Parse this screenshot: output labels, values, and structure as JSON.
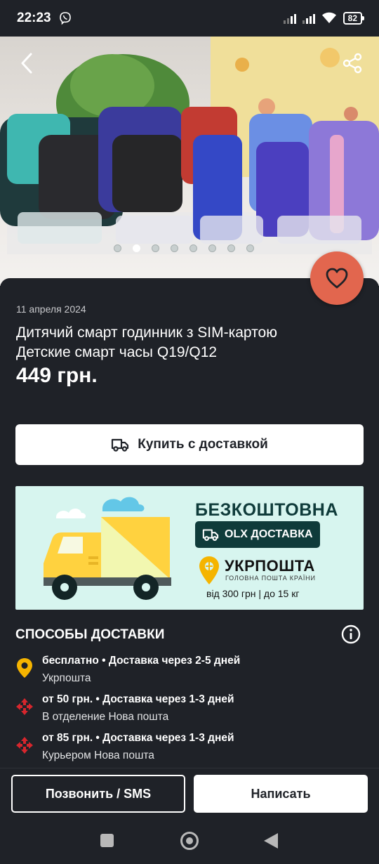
{
  "status_bar": {
    "time": "22:23",
    "battery": "82"
  },
  "gallery": {
    "total_images": 8,
    "active_index": 1
  },
  "listing": {
    "date": "11 апреля 2024",
    "title": "Дитячий смарт годинник з SIM-картою Детские смарт часы  Q19/Q12",
    "price": "449 грн."
  },
  "buy_button": {
    "label": "Купить с доставкой"
  },
  "banner": {
    "headline": "БЕЗКОШТОВНА",
    "olx_label": "OLX ДОСТАВКА",
    "ukrposhta_name": "УКРПОШТА",
    "ukrposhta_tagline": "ГОЛОВНА ПОШТА КРАЇНИ",
    "conditions": "від 300 грн | до 15 кг"
  },
  "delivery": {
    "title": "СПОСОБЫ ДОСТАВКИ",
    "methods": [
      {
        "icon": "ukrposhta-icon",
        "price": "бесплатно",
        "term": "Доставка через 2-5 дней",
        "line1": "бесплатно • Доставка через 2-5 дней",
        "carrier": "Укрпошта"
      },
      {
        "icon": "nova-poshta-icon",
        "price": "от 50 грн.",
        "term": "Доставка через 1-3 дней",
        "line1": "от 50 грн. • Доставка через 1-3 дней",
        "carrier": "В отделение Нова пошта"
      },
      {
        "icon": "nova-poshta-icon",
        "price": "от 85 грн.",
        "term": "Доставка через 1-3 дней",
        "line1": "от 85 грн. • Доставка через 1-3 дней",
        "carrier": "Курьером Нова пошта"
      }
    ]
  },
  "actions": {
    "call_label": "Позвонить / SMS",
    "write_label": "Написать"
  },
  "colors": {
    "background": "#1f2228",
    "favorite": "#e2664e",
    "banner_bg": "#d7f5ef",
    "banner_dark": "#0f3b3a",
    "ukrposhta_yellow": "#f5b400",
    "nova_poshta_red": "#d7262d"
  }
}
